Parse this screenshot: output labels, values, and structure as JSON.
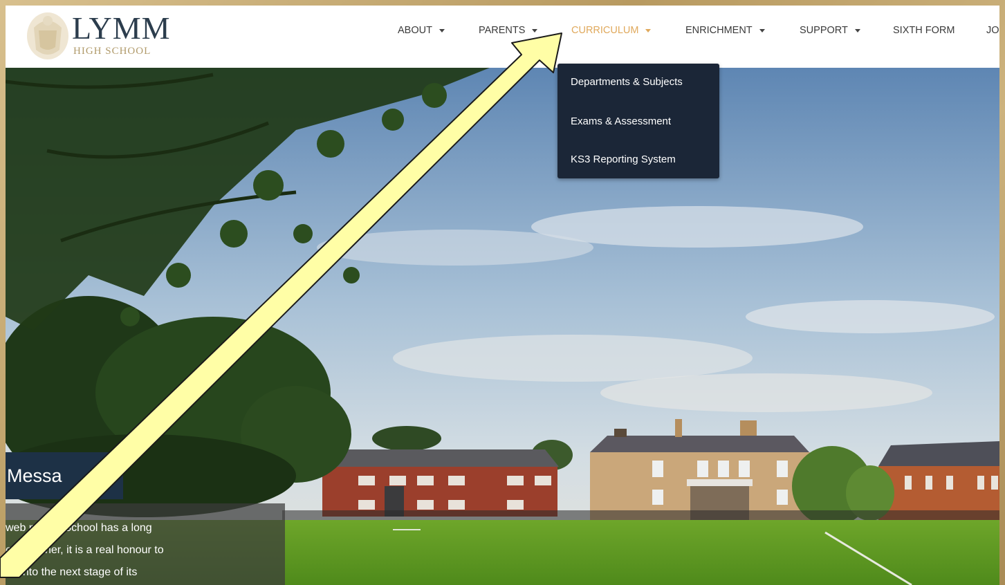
{
  "logo": {
    "name": "LYMM",
    "subtitle": "HIGH SCHOOL"
  },
  "nav": {
    "items": [
      {
        "label": "ABOUT",
        "has_dropdown": true,
        "active": false
      },
      {
        "label": "PARENTS",
        "has_dropdown": true,
        "active": false
      },
      {
        "label": "CURRICULUM",
        "has_dropdown": true,
        "active": true
      },
      {
        "label": "ENRICHMENT",
        "has_dropdown": true,
        "active": false
      },
      {
        "label": "SUPPORT",
        "has_dropdown": true,
        "active": false
      },
      {
        "label": "SIXTH FORM",
        "has_dropdown": false,
        "active": false
      },
      {
        "label": "JOI",
        "has_dropdown": false,
        "active": false
      }
    ],
    "active_color": "#e0a95c"
  },
  "dropdown": {
    "items": [
      "Departments & Subjects",
      "Exams & Assessment",
      "KS3 Reporting System"
    ],
    "background": "#1b2637"
  },
  "message": {
    "title": "Messa",
    "lines": [
      "web        n High School has a long",
      "        eadteacher, it is a real honour to",
      "      ce into the next stage of its"
    ]
  },
  "annotation": {
    "arrow_color": "#fffea6",
    "arrow_outline": "#1a1a1a"
  },
  "colors": {
    "frame": "#c9b07a",
    "header_bg": "#ffffff",
    "message_title_bg": "#1d3146"
  }
}
